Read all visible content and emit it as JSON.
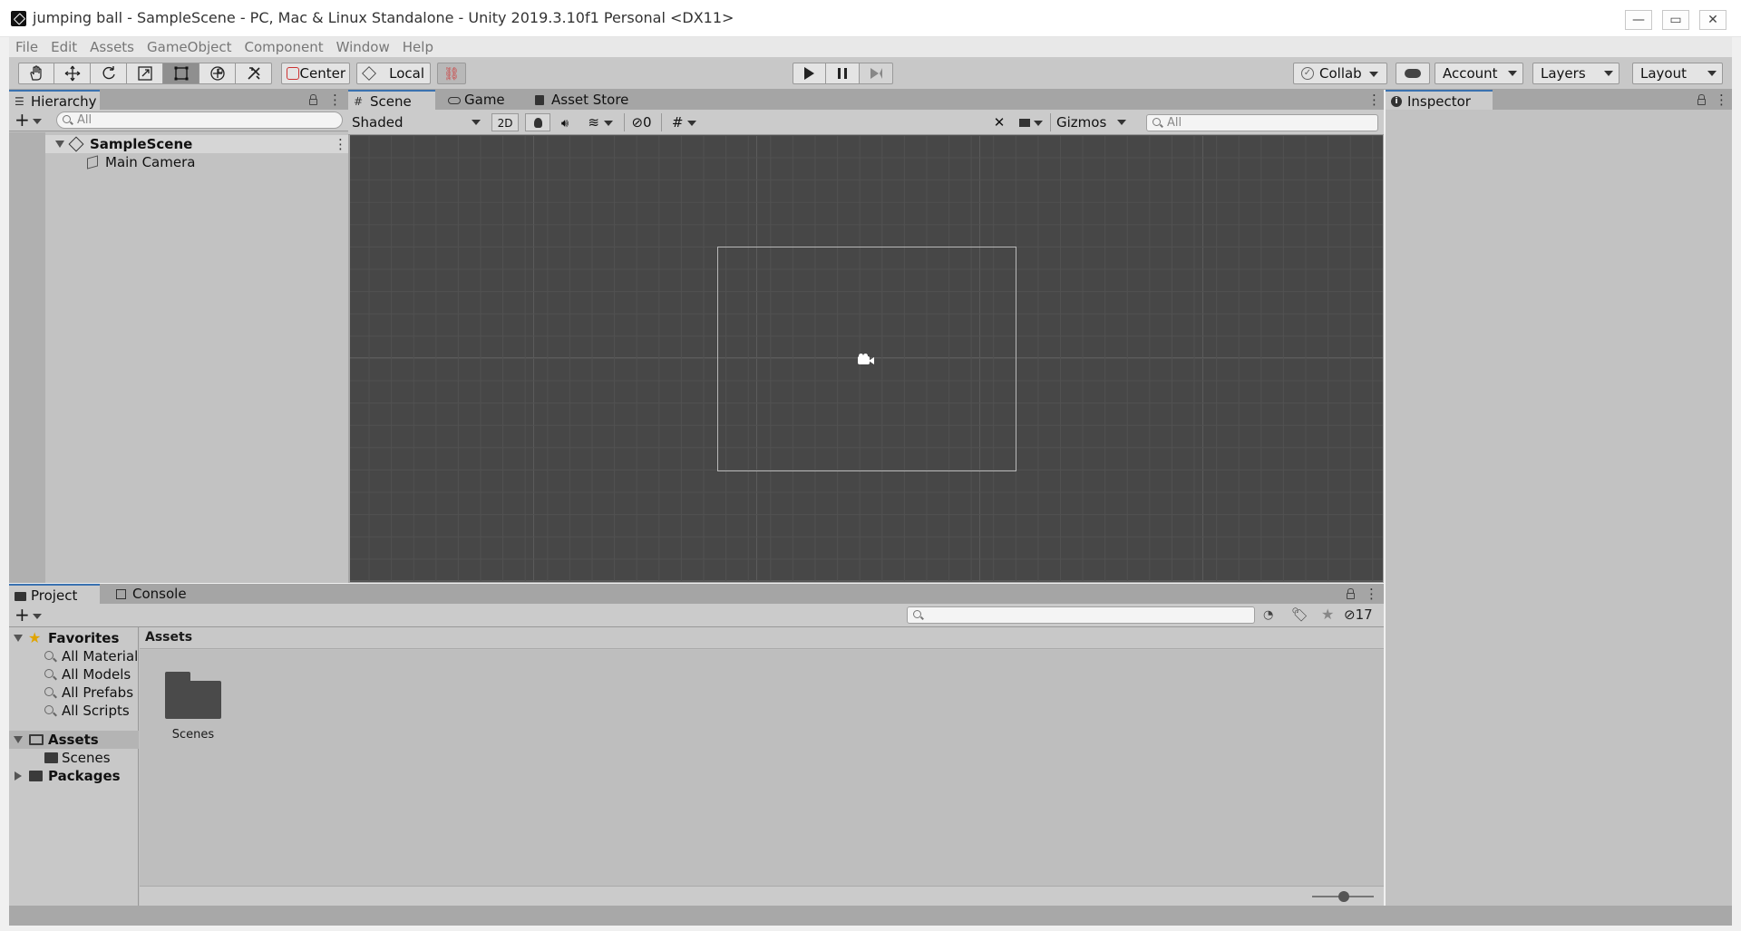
{
  "window": {
    "title": "jumping ball - SampleScene - PC, Mac & Linux Standalone - Unity 2019.3.10f1 Personal <DX11>",
    "controls": {
      "minimize": "—",
      "maximize": "▭",
      "close": "✕"
    }
  },
  "menu": [
    "File",
    "Edit",
    "Assets",
    "GameObject",
    "Component",
    "Window",
    "Help"
  ],
  "toolbar": {
    "transform_tools": [
      "hand-tool-icon",
      "move-tool-icon",
      "rotate-tool-icon",
      "scale-tool-icon",
      "rect-tool-icon",
      "transform-tool-icon",
      "custom-tool-icon"
    ],
    "active_tool": "rect-tool-icon",
    "pivot_label": "Center",
    "space_label": "Local",
    "collab_label": "Collab",
    "account_label": "Account",
    "layers_label": "Layers",
    "layout_label": "Layout"
  },
  "hierarchy": {
    "tab_label": "Hierarchy",
    "add_label": "+",
    "search_placeholder": "All",
    "scene_name": "SampleScene",
    "objects": [
      "Main Camera"
    ]
  },
  "scene": {
    "tabs": [
      "Scene",
      "Game",
      "Asset Store"
    ],
    "shading_mode": "Shaded",
    "two_d_label": "2D",
    "hidden_count": "0",
    "gizmos_label": "Gizmos",
    "search_placeholder": "All"
  },
  "inspector": {
    "tab_label": "Inspector"
  },
  "project": {
    "tabs": [
      "Project",
      "Console"
    ],
    "add_label": "+",
    "hidden_count": "17",
    "favorites_label": "Favorites",
    "favorites": [
      "All Materials",
      "All Models",
      "All Prefabs",
      "All Scripts"
    ],
    "assets_label": "Assets",
    "asset_children": [
      "Scenes"
    ],
    "packages_label": "Packages",
    "breadcrumb": "Assets",
    "items": [
      {
        "name": "Scenes",
        "icon": "folder-icon"
      }
    ],
    "zoom_level": 0.5
  },
  "colors": {
    "accent_tab": "#3a72b0",
    "scene_bg": "#474747",
    "panel_bg": "#c2c2c2",
    "favorites_star": "#e0a400"
  }
}
